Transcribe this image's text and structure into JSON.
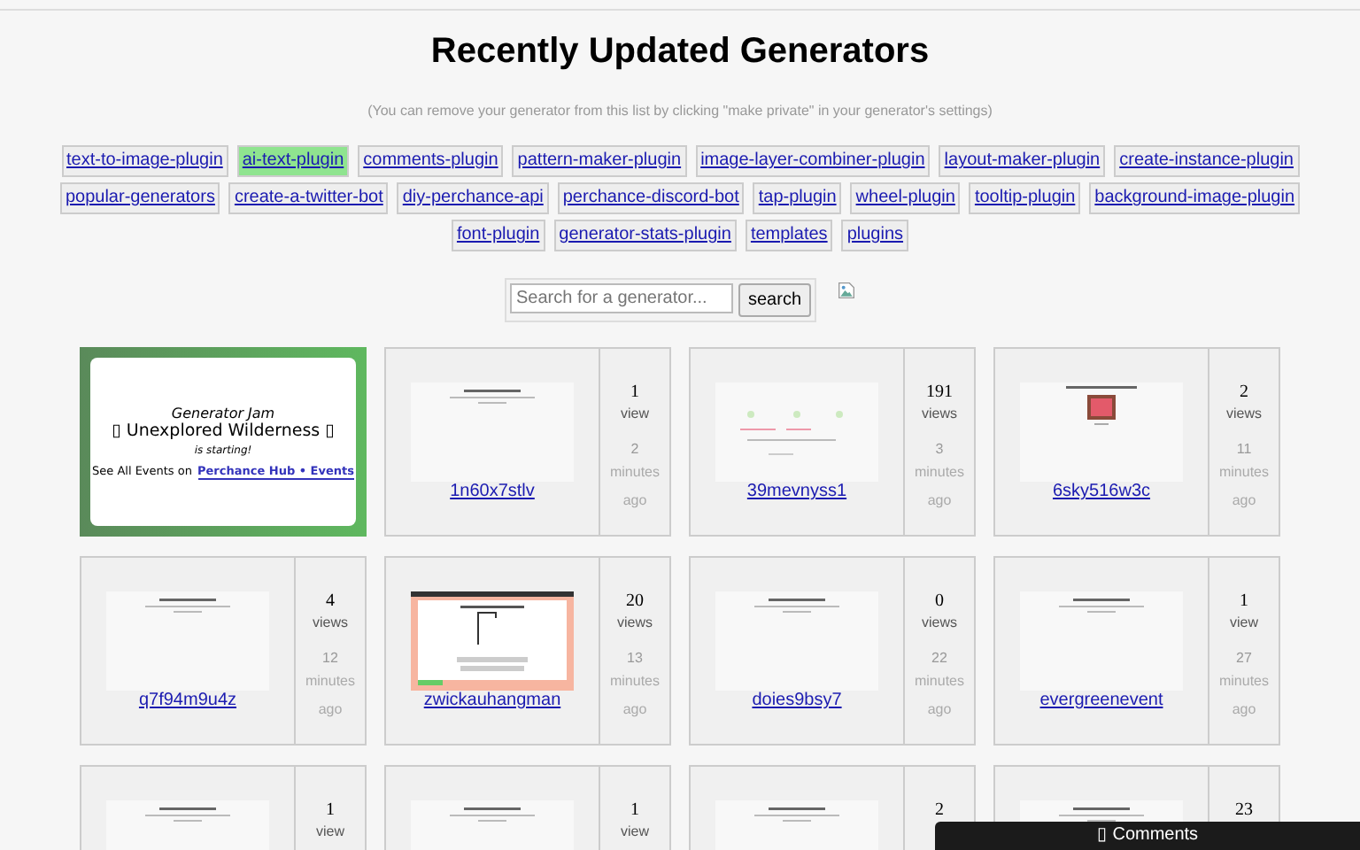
{
  "title": "Recently Updated Generators",
  "subtitle": "(You can remove your generator from this list by clicking \"make private\" in your generator's settings)",
  "tags": [
    {
      "label": "text-to-image-plugin",
      "selected": false
    },
    {
      "label": "ai-text-plugin",
      "selected": true
    },
    {
      "label": "comments-plugin",
      "selected": false
    },
    {
      "label": "pattern-maker-plugin",
      "selected": false
    },
    {
      "label": "image-layer-combiner-plugin",
      "selected": false
    },
    {
      "label": "layout-maker-plugin",
      "selected": false
    },
    {
      "label": "create-instance-plugin",
      "selected": false
    },
    {
      "label": "popular-generators",
      "selected": false
    },
    {
      "label": "create-a-twitter-bot",
      "selected": false
    },
    {
      "label": "diy-perchance-api",
      "selected": false
    },
    {
      "label": "perchance-discord-bot",
      "selected": false
    },
    {
      "label": "tap-plugin",
      "selected": false
    },
    {
      "label": "wheel-plugin",
      "selected": false
    },
    {
      "label": "tooltip-plugin",
      "selected": false
    },
    {
      "label": "background-image-plugin",
      "selected": false
    },
    {
      "label": "font-plugin",
      "selected": false
    },
    {
      "label": "generator-stats-plugin",
      "selected": false
    },
    {
      "label": "templates",
      "selected": false
    },
    {
      "label": "plugins",
      "selected": false
    }
  ],
  "search": {
    "placeholder": "Search for a generator...",
    "button": "search"
  },
  "event": {
    "line1": "Generator Jam",
    "line2": "▯ Unexplored Wilderness ▯",
    "line3": "is starting!",
    "prefix": "See All Events on",
    "link": "Perchance Hub • Events"
  },
  "generators": [
    {
      "name": "1n60x7stlv",
      "views": "1",
      "views_label": "view",
      "age": "2",
      "age_text": "minutes ago"
    },
    {
      "name": "39mevnyss1",
      "views": "191",
      "views_label": "views",
      "age": "3",
      "age_text": "minutes ago"
    },
    {
      "name": "6sky516w3c",
      "views": "2",
      "views_label": "views",
      "age": "11",
      "age_text": "minutes ago"
    },
    {
      "name": "q7f94m9u4z",
      "views": "4",
      "views_label": "views",
      "age": "12",
      "age_text": "minutes ago"
    },
    {
      "name": "zwickauhangman",
      "views": "20",
      "views_label": "views",
      "age": "13",
      "age_text": "minutes ago"
    },
    {
      "name": "doies9bsy7",
      "views": "0",
      "views_label": "views",
      "age": "22",
      "age_text": "minutes ago"
    },
    {
      "name": "evergreenevent",
      "views": "1",
      "views_label": "view",
      "age": "27",
      "age_text": "minutes ago"
    },
    {
      "views": "1",
      "views_label": "view"
    },
    {
      "views": "1",
      "views_label": "view"
    },
    {
      "views": "2"
    },
    {
      "views": "23"
    }
  ],
  "comments_bar": {
    "label": "▯ Comments"
  }
}
